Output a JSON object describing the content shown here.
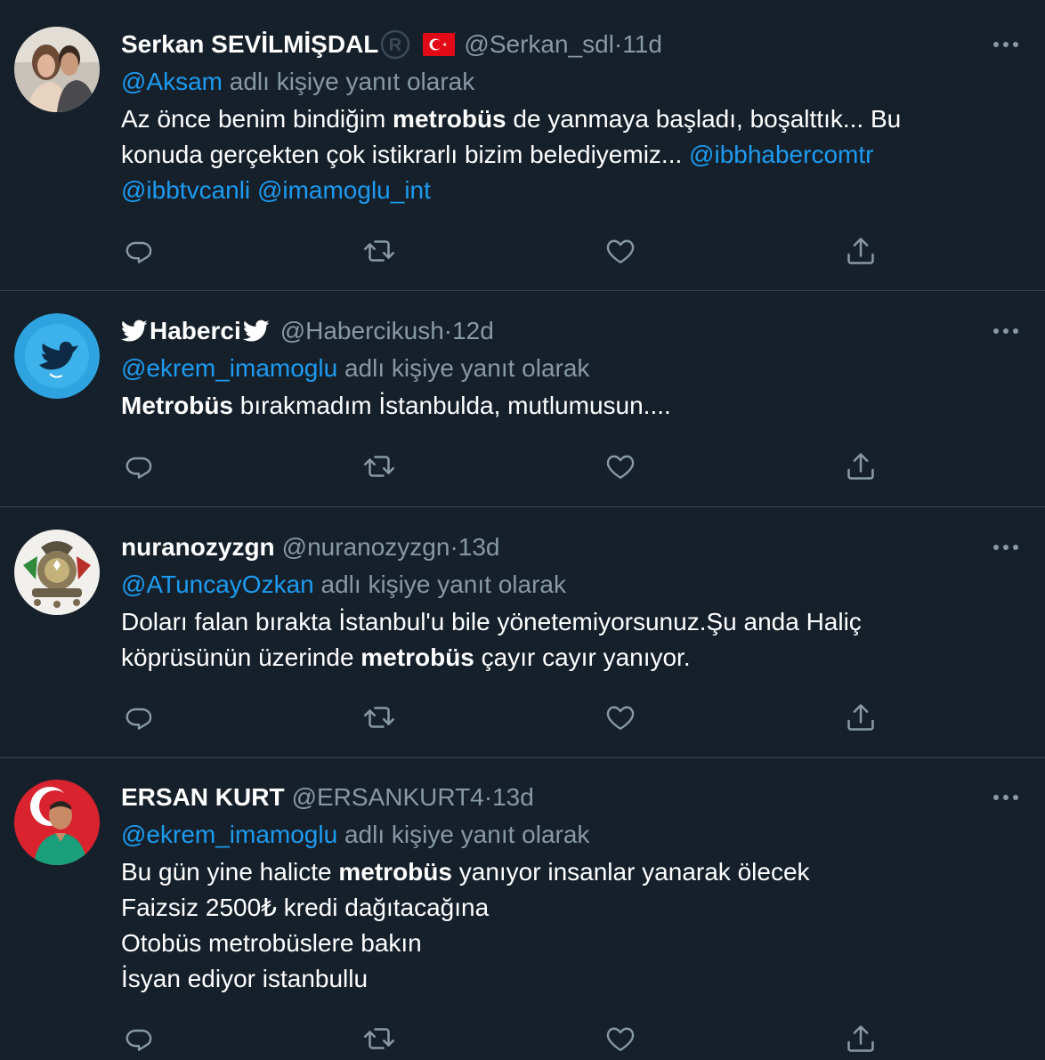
{
  "colors": {
    "background": "#15202b",
    "divider": "#38444d",
    "secondary_text": "#8899a6",
    "link": "#1d9bf0",
    "primary_text": "#ffffff"
  },
  "labels": {
    "reply_suffix": " adlı kişiye yanıt olarak",
    "separator": " · "
  },
  "tweets": [
    {
      "name": "Serkan SEVİLMİŞDAL",
      "name_badges": [
        "registered-mark-icon",
        "turkey-flag-icon"
      ],
      "handle": "@Serkan_sdl",
      "time": "11d",
      "reply_to": "@Aksam",
      "text_parts": [
        {
          "t": "Az önce benim bindiğim ",
          "s": "plain"
        },
        {
          "t": "metrobüs",
          "s": "bold"
        },
        {
          "t": " de yanmaya başladı, boşalttık... Bu konuda gerçekten çok istikrarlı bizim belediyemiz... ",
          "s": "plain"
        },
        {
          "t": "@ibbhabercomtr",
          "s": "link"
        },
        {
          "t": " ",
          "s": "plain"
        },
        {
          "t": "@ibbtvcanli",
          "s": "link"
        },
        {
          "t": " ",
          "s": "plain"
        },
        {
          "t": "@imamoglu_int",
          "s": "link"
        }
      ]
    },
    {
      "name": "Haberci",
      "name_badges": [
        "bird-icon-left",
        "bird-icon-right"
      ],
      "handle": "@Habercikush",
      "time": "12d",
      "reply_to": "@ekrem_imamoglu",
      "text_parts": [
        {
          "t": "Metrobüs",
          "s": "bold"
        },
        {
          "t": " bırakmadım İstanbulda, mutlumusun....",
          "s": "plain"
        }
      ]
    },
    {
      "name": "nuranozyzgn",
      "name_badges": [],
      "handle": "@nuranozyzgn",
      "time": "13d",
      "reply_to": "@ATuncayOzkan",
      "text_parts": [
        {
          "t": "Doları falan bırakta İstanbul'u bile yönetemiyorsunuz.Şu anda Haliç köprüsünün üzerinde ",
          "s": "plain"
        },
        {
          "t": "metrobüs",
          "s": "bold"
        },
        {
          "t": " çayır cayır yanıyor.",
          "s": "plain"
        }
      ]
    },
    {
      "name": "ERSAN KURT",
      "name_badges": [],
      "handle": "@ERSANKURT4",
      "time": "13d",
      "reply_to": "@ekrem_imamoglu",
      "text_parts": [
        {
          "t": "Bu gün yine halicte ",
          "s": "plain"
        },
        {
          "t": "metrobüs",
          "s": "bold"
        },
        {
          "t": " yanıyor insanlar yanarak ölecek",
          "s": "plain"
        },
        {
          "t": "\n",
          "s": "br"
        },
        {
          "t": "Faizsiz 2500₺ kredi dağıtacağına",
          "s": "plain"
        },
        {
          "t": "\n",
          "s": "br"
        },
        {
          "t": "Otobüs metrobüslere bakın",
          "s": "plain"
        },
        {
          "t": "\n",
          "s": "br"
        },
        {
          "t": "İsyan ediyor istanbullu",
          "s": "plain"
        }
      ]
    }
  ],
  "action_icons": [
    "reply-icon",
    "retweet-icon",
    "like-icon",
    "share-icon"
  ]
}
